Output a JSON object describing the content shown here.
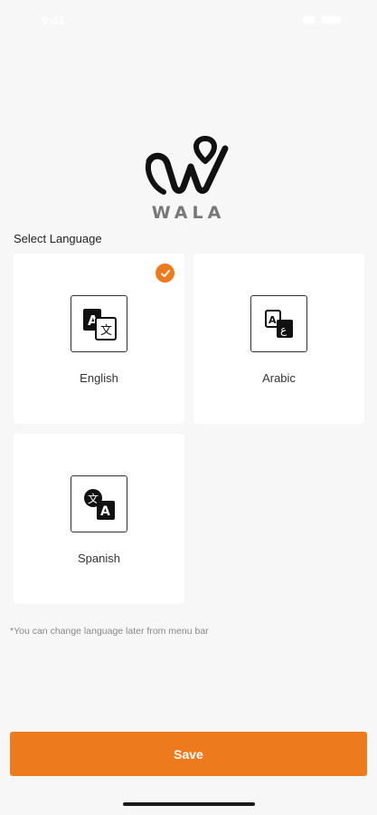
{
  "status_bar": {
    "time": "9:41"
  },
  "brand": {
    "name": "WALA",
    "accent": "#ee7a1e"
  },
  "section_label": "Select Language",
  "languages": [
    {
      "label": "English",
      "icon": "translate-en-icon",
      "selected": true
    },
    {
      "label": "Arabic",
      "icon": "translate-ar-icon",
      "selected": false
    },
    {
      "label": "Spanish",
      "icon": "translate-es-icon",
      "selected": false
    }
  ],
  "note": "*You can change language later from menu bar",
  "save_label": "Save"
}
